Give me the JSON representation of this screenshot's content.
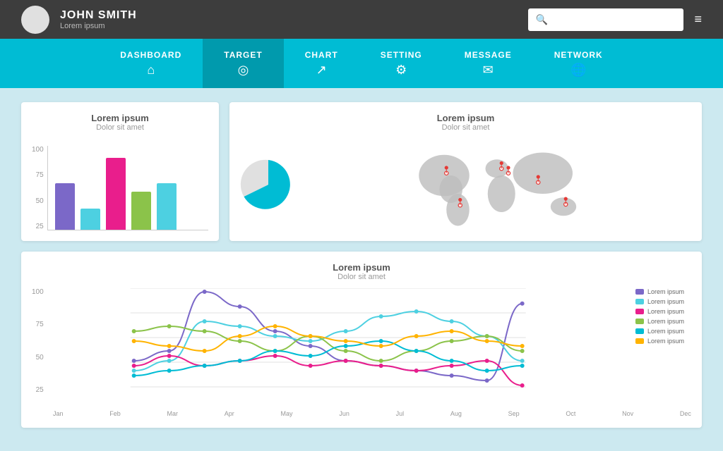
{
  "header": {
    "user_name": "JOHN SMITH",
    "user_subtitle": "Lorem ipsum",
    "search_placeholder": "",
    "hamburger_icon": "≡"
  },
  "nav": {
    "items": [
      {
        "id": "dashboard",
        "label": "DASHBOARD",
        "icon": "⌂",
        "active": false
      },
      {
        "id": "target",
        "label": "TARGET",
        "icon": "◎",
        "active": true
      },
      {
        "id": "chart",
        "label": "CHART",
        "icon": "↗",
        "active": false
      },
      {
        "id": "setting",
        "label": "SETTING",
        "icon": "⚙",
        "active": false
      },
      {
        "id": "message",
        "label": "MESSAGE",
        "icon": "✉",
        "active": false
      },
      {
        "id": "network",
        "label": "NETWORK",
        "icon": "🌐",
        "active": false
      }
    ]
  },
  "bar_chart": {
    "title": "Lorem ipsum",
    "subtitle": "Dolor sit amet",
    "y_labels": [
      "100",
      "75",
      "50",
      "25"
    ],
    "bars": [
      {
        "color": "#7b68c8",
        "height_pct": 55
      },
      {
        "color": "#4dd0e1",
        "height_pct": 25
      },
      {
        "color": "#e91e8c",
        "height_pct": 85
      },
      {
        "color": "#8bc34a",
        "height_pct": 45
      },
      {
        "color": "#4dd0e1",
        "height_pct": 55
      }
    ]
  },
  "map_chart": {
    "title": "Lorem ipsum",
    "subtitle": "Dolor sit amet"
  },
  "line_chart": {
    "title": "Lorem ipsum",
    "subtitle": "Dolor sit amet",
    "y_labels": [
      "100",
      "75",
      "50",
      "25"
    ],
    "x_labels": [
      "Jan",
      "Feb",
      "Mar",
      "Apr",
      "May",
      "Jun",
      "Jul",
      "Aug",
      "Sep",
      "Oct",
      "Nov",
      "Dec"
    ],
    "legend": [
      {
        "label": "Lorem ipsum",
        "color": "#7b68c8"
      },
      {
        "label": "Lorem ipsum",
        "color": "#4dd0e1"
      },
      {
        "label": "Lorem ipsum",
        "color": "#e91e8c"
      },
      {
        "label": "Lorem ipsum",
        "color": "#8bc34a"
      },
      {
        "label": "Lorem ipsum",
        "color": "#00bcd4"
      },
      {
        "label": "Lorem ipsum",
        "color": "#ffb300"
      }
    ],
    "series": [
      {
        "color": "#7b68c8",
        "points": [
          30,
          40,
          100,
          85,
          60,
          45,
          30,
          25,
          20,
          15,
          10,
          88
        ]
      },
      {
        "color": "#4dd0e1",
        "points": [
          20,
          30,
          70,
          65,
          55,
          50,
          60,
          75,
          80,
          70,
          55,
          30
        ]
      },
      {
        "color": "#e91e8c",
        "points": [
          25,
          35,
          25,
          30,
          35,
          25,
          30,
          25,
          20,
          25,
          30,
          5
        ]
      },
      {
        "color": "#8bc34a",
        "points": [
          60,
          65,
          60,
          50,
          40,
          55,
          40,
          30,
          40,
          50,
          55,
          40
        ]
      },
      {
        "color": "#00bcd4",
        "points": [
          15,
          20,
          25,
          30,
          40,
          35,
          45,
          50,
          40,
          30,
          20,
          25
        ]
      },
      {
        "color": "#ffb300",
        "points": [
          50,
          45,
          40,
          55,
          65,
          55,
          50,
          45,
          55,
          60,
          50,
          45
        ]
      }
    ]
  }
}
